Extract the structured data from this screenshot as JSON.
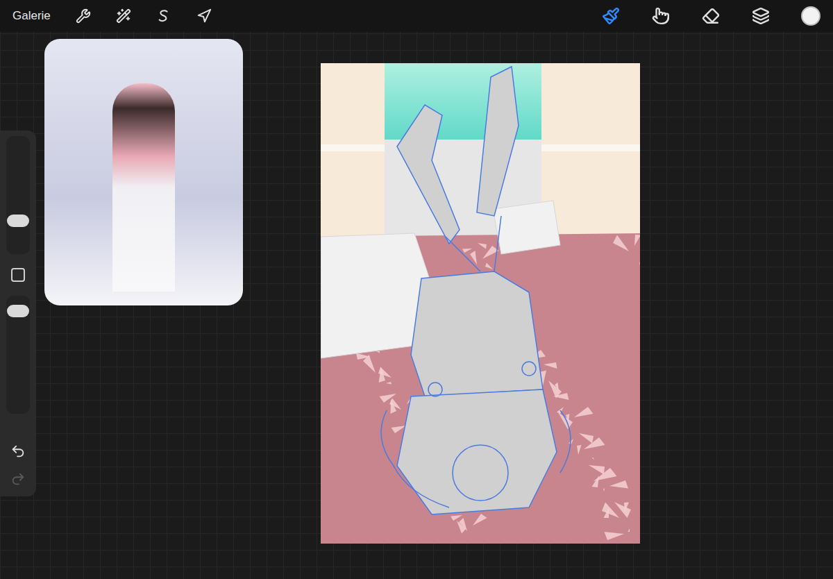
{
  "toolbar": {
    "gallery": "Galerie",
    "left_tools": [
      {
        "kind": "wrench",
        "selected": false
      },
      {
        "kind": "wand",
        "selected": false
      },
      {
        "kind": "selection",
        "selected": false
      },
      {
        "kind": "transform",
        "selected": false
      }
    ],
    "right_tools": [
      {
        "kind": "brush",
        "selected": true
      },
      {
        "kind": "smudge",
        "selected": false
      },
      {
        "kind": "eraser",
        "selected": false
      },
      {
        "kind": "layers",
        "selected": false
      }
    ],
    "current_color": "#f2f2f2"
  },
  "sidebar": {
    "brush_size": {
      "level": 0.28
    },
    "opacity": {
      "level": 0.87
    },
    "undo_disabled": false,
    "redo_disabled": true
  }
}
